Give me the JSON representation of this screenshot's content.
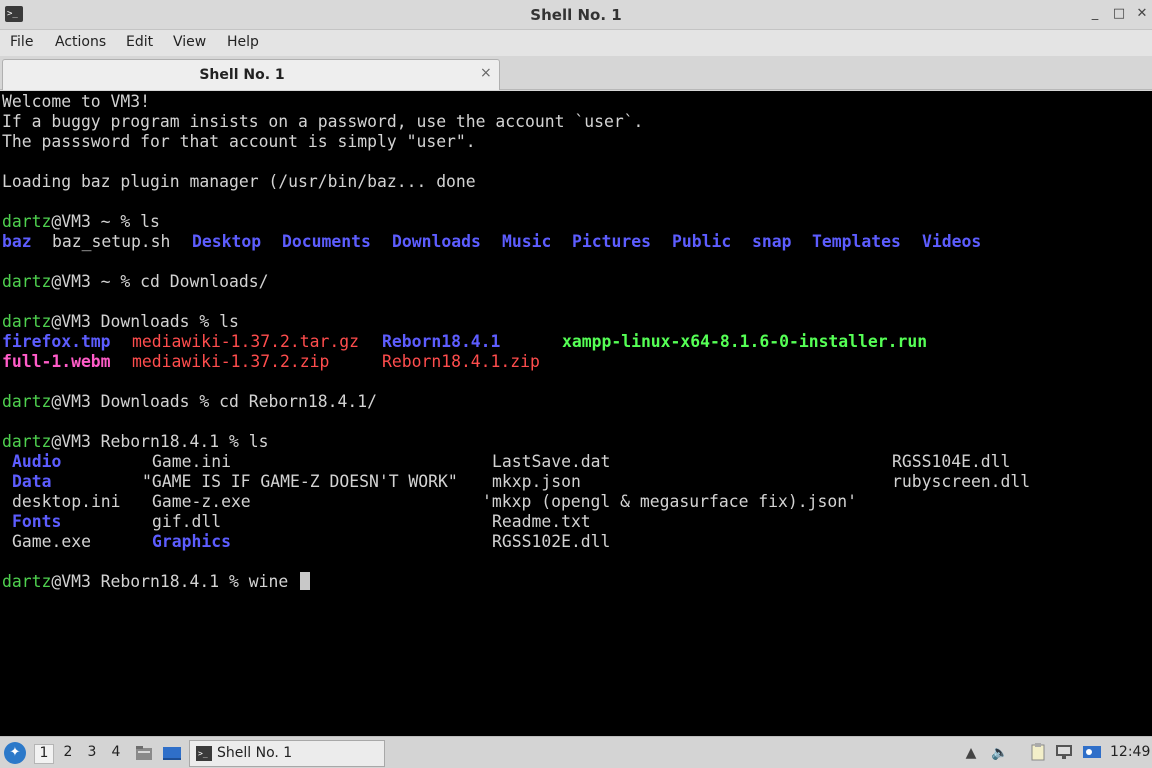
{
  "window": {
    "title": "Shell No. 1",
    "controls": {
      "minimize": "_",
      "maximize": "□",
      "close": "✕"
    }
  },
  "menu": [
    "File",
    "Actions",
    "Edit",
    "View",
    "Help"
  ],
  "tab": {
    "label": "Shell No. 1",
    "close": "×"
  },
  "terminal": {
    "welcome": [
      "Welcome to VM3!",
      "If a buggy program insists on a password, use the account `user`.",
      "The passsword for that account is simply \"user\"."
    ],
    "loading": "Loading baz plugin manager (/usr/bin/baz... done",
    "user": "dartz",
    "prompts": [
      {
        "host_path": "@VM3 ~ % ",
        "cmd": "ls"
      },
      {
        "host_path": "@VM3 ~ % ",
        "cmd": "cd Downloads/"
      },
      {
        "host_path": "@VM3 Downloads % ",
        "cmd": "ls"
      },
      {
        "host_path": "@VM3 Downloads % ",
        "cmd": "cd Reborn18.4.1/"
      },
      {
        "host_path": "@VM3 Reborn18.4.1 % ",
        "cmd": "ls"
      },
      {
        "host_path": "@VM3 Reborn18.4.1 % ",
        "cmd": "wine "
      }
    ],
    "home_ls": [
      "baz",
      "baz_setup.sh",
      "Desktop",
      "Documents",
      "Downloads",
      "Music",
      "Pictures",
      "Public",
      "snap",
      "Templates",
      "Videos"
    ],
    "downloads_ls": {
      "row1": [
        "firefox.tmp",
        "mediawiki-1.37.2.tar.gz",
        "Reborn18.4.1",
        "xampp-linux-x64-8.1.6-0-installer.run"
      ],
      "row2": [
        "full-1.webm",
        "mediawiki-1.37.2.zip",
        "Reborn18.4.1.zip"
      ]
    },
    "reborn_ls": {
      "col1": [
        "Audio",
        "Data",
        "desktop.ini",
        "Fonts",
        "Game.exe"
      ],
      "col2": [
        "Game.ini",
        "\"GAME IS IF GAME-Z DOESN'T WORK\"",
        "Game-z.exe",
        "gif.dll",
        "Graphics"
      ],
      "col3": [
        "LastSave.dat",
        "mkxp.json",
        "'mkxp (opengl & megasurface fix).json'",
        "Readme.txt",
        "RGSS102E.dll"
      ],
      "col4": [
        "RGSS104E.dll",
        "rubyscreen.dll"
      ]
    }
  },
  "taskbar": {
    "workspaces": [
      "1",
      "2",
      "3",
      "4"
    ],
    "task": "Shell No. 1",
    "clock": "12:49"
  }
}
